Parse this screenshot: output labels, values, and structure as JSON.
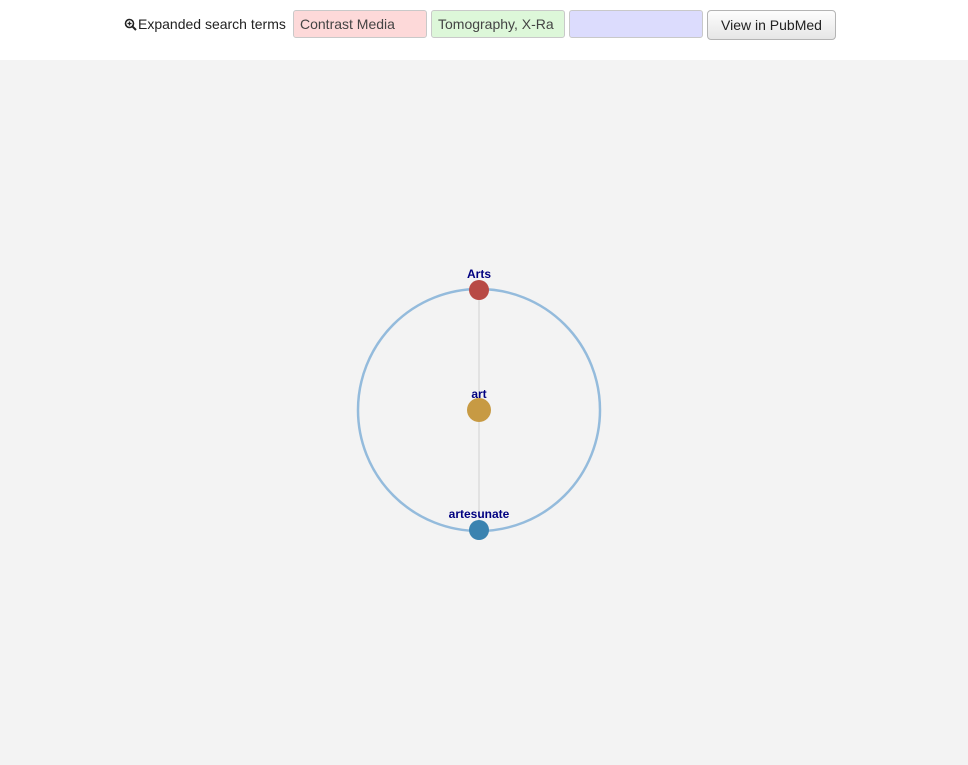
{
  "search": {
    "label": "Expanded search terms",
    "icon": "zoom-in-icon",
    "terms": [
      {
        "value": "Contrast Media",
        "color": "#fdd9d9"
      },
      {
        "value": "Tomography, X-Ra",
        "color": "#ddf7d9"
      },
      {
        "value": "",
        "color": "#dcdcfd"
      }
    ],
    "button_label": "View in PubMed"
  },
  "graph": {
    "background": "#f3f3f3",
    "ring_color": "#94bbdc",
    "edge_color": "#dddddd",
    "label_color": "#000080",
    "nodes": [
      {
        "id": "Arts",
        "label": "Arts",
        "color": "#b84a45"
      },
      {
        "id": "art",
        "label": "art",
        "color": "#c79a43"
      },
      {
        "id": "artesunate",
        "label": "artesunate",
        "color": "#3a83b0"
      }
    ]
  }
}
